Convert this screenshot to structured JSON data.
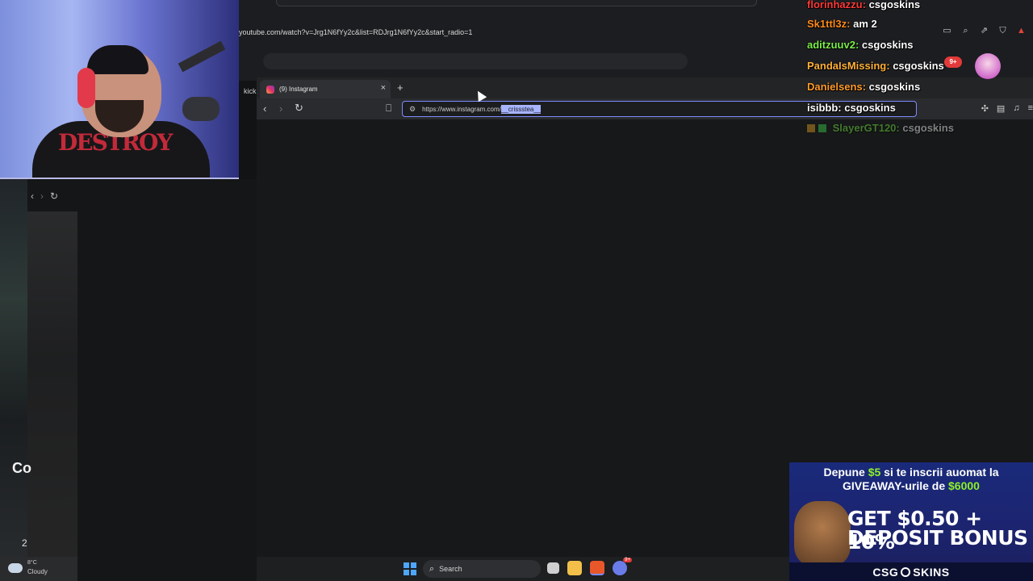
{
  "youtube_window": {
    "url": "youtube.com/watch?v=Jrg1N6fYy2c&list=RDJrg1N6fYy2c&start_radio=1",
    "partial_tab_label": "kick"
  },
  "left_window": {
    "partial_title": "Co",
    "partial_number": "2",
    "weather": {
      "temp": "8°C",
      "condition": "Cloudy"
    }
  },
  "browser": {
    "tab": {
      "title": "(9) Instagram"
    },
    "new_tab_symbol": "+",
    "url_base": "https://www.instagram.com/",
    "url_selected": "__crissstea__"
  },
  "taskbar": {
    "search_placeholder": "Search",
    "discord_badge": "9+"
  },
  "chat": {
    "messages": [
      {
        "user": "florinhazzu:",
        "message": "csgoskins",
        "user_color": "#ff3a3a",
        "faded": false
      },
      {
        "user": "Sk1ttl3z:",
        "message": "am 2",
        "user_color": "#ff8a1a",
        "faded": false
      },
      {
        "user": "aditzuuv2:",
        "message": "csgoskins",
        "user_color": "#7cf04a",
        "faded": false
      },
      {
        "user": "PandaIsMissing:",
        "message": "csgoskins",
        "user_color": "#ffb13a",
        "faded": false
      },
      {
        "user": "Danielsens:",
        "message": "csgoskins",
        "user_color": "#ff9c2a",
        "faded": false
      },
      {
        "user": "isibbb:",
        "message": "csgoskins",
        "user_color": "#ffffff",
        "faded": false
      },
      {
        "user": "SlayerGT120:",
        "message": "csgoskins",
        "user_color": "#7cf04a",
        "faded": true
      }
    ],
    "notif_badge": "9+"
  },
  "ad": {
    "line1_a": "Depune ",
    "line1_amount": "$5",
    "line1_b": " si te inscrii auomat la",
    "line2_a": "GIVEAWAY-urile de ",
    "line2_amount": "$6000",
    "headline1": "GET $0.50 + 10%",
    "headline2": "DEPOSIT BONUS",
    "brand_a": "CSG",
    "brand_b": "SKINS"
  }
}
